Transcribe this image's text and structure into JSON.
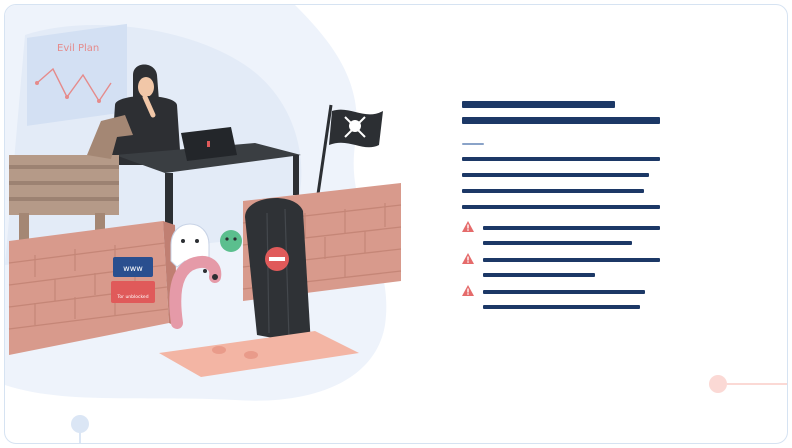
{
  "illustration": {
    "whiteboard_title": "Evil Plan",
    "sign_url": "www",
    "sign_warning": "Tor unblocked"
  },
  "colors": {
    "text_bar": "#1c3866",
    "warning": "#e56b6b",
    "brick": "#d89a8c",
    "accent_blue": "#dbe6f5"
  },
  "icons": [
    "warning-icon",
    "skull-flag-icon",
    "no-entry-icon",
    "virus-icon",
    "ghost-icon"
  ]
}
